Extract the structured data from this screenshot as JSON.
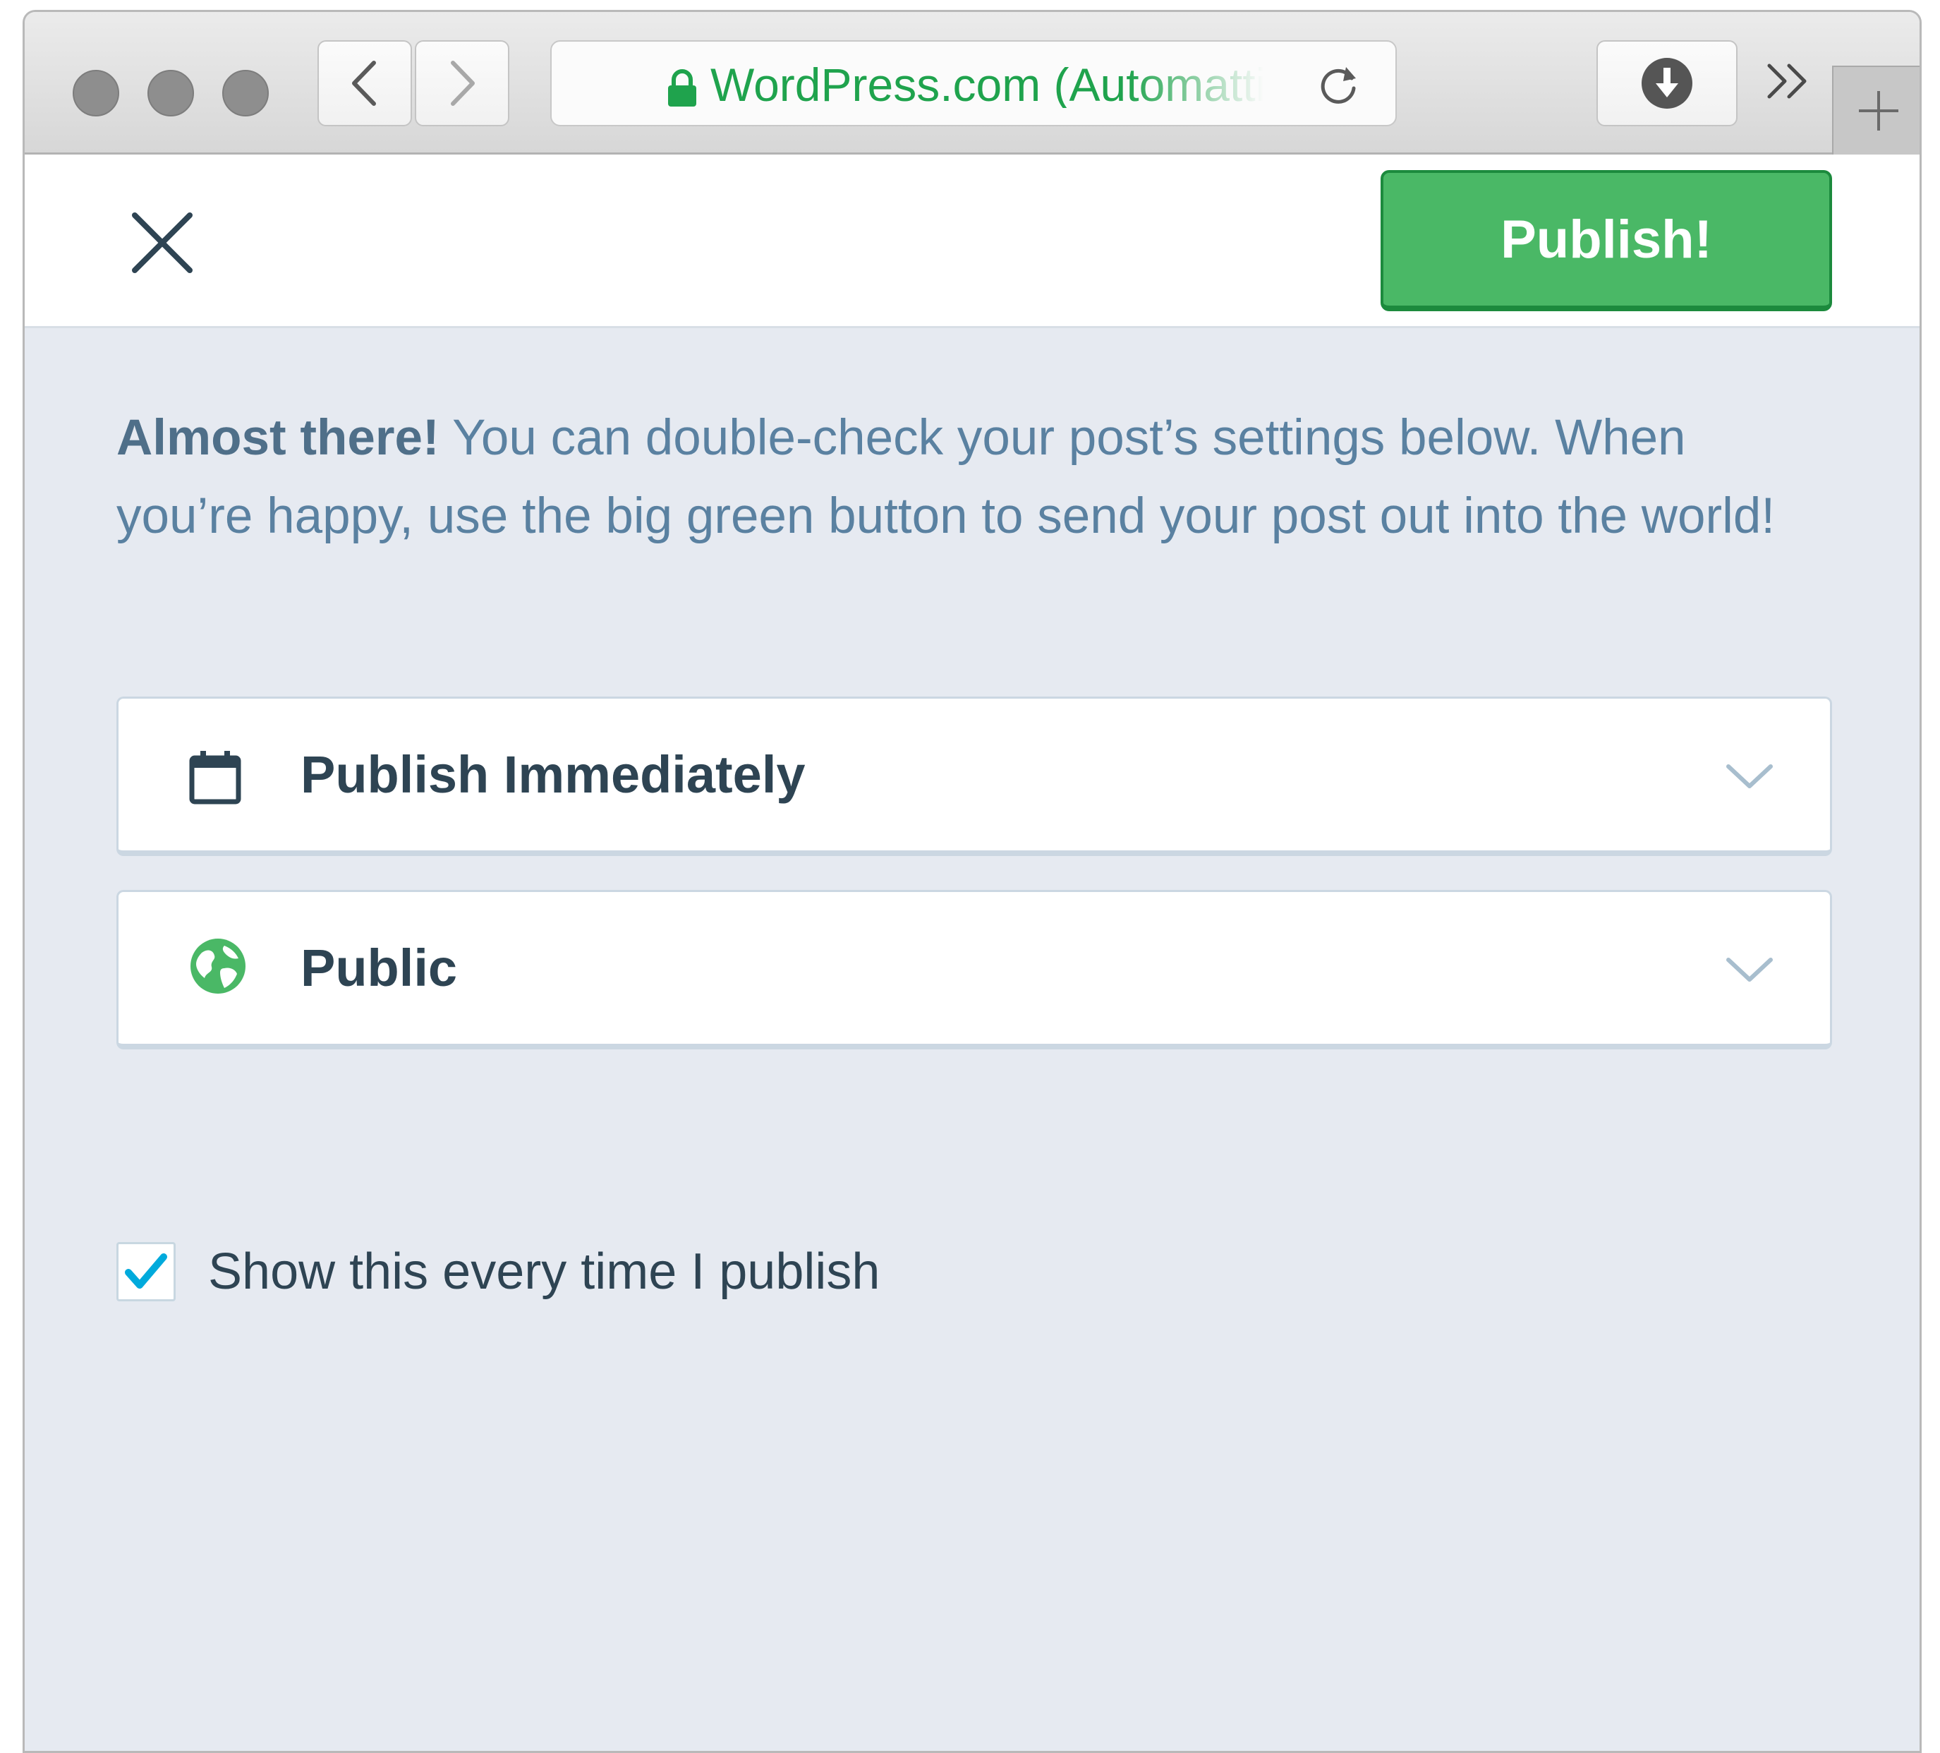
{
  "browser": {
    "url_text": "WordPress.com (Automattic, Inc.)",
    "icons": {
      "back": "chevron-left-icon",
      "forward": "chevron-right-icon",
      "lock": "lock-icon",
      "reload": "reload-icon",
      "download": "download-icon",
      "overflow": "double-chevron-right-icon",
      "new_tab": "plus-icon"
    },
    "colors": {
      "url_green": "#1fa34d"
    }
  },
  "header": {
    "close_icon": "close-icon",
    "publish_label": "Publish!",
    "publish_color": "#4ab866"
  },
  "intro": {
    "lead": "Almost there!",
    "body": " You can double-check your post’s settings below. When you’re happy, use the big green button to send your post out into the world!"
  },
  "settings": [
    {
      "label": "Publish Immediately",
      "icon": "calendar-icon"
    },
    {
      "label": "Public",
      "icon": "globe-icon",
      "icon_color": "#4ab866"
    }
  ],
  "preference": {
    "label": "Show this every time I publish",
    "checked": true,
    "check_color": "#00aadc"
  }
}
